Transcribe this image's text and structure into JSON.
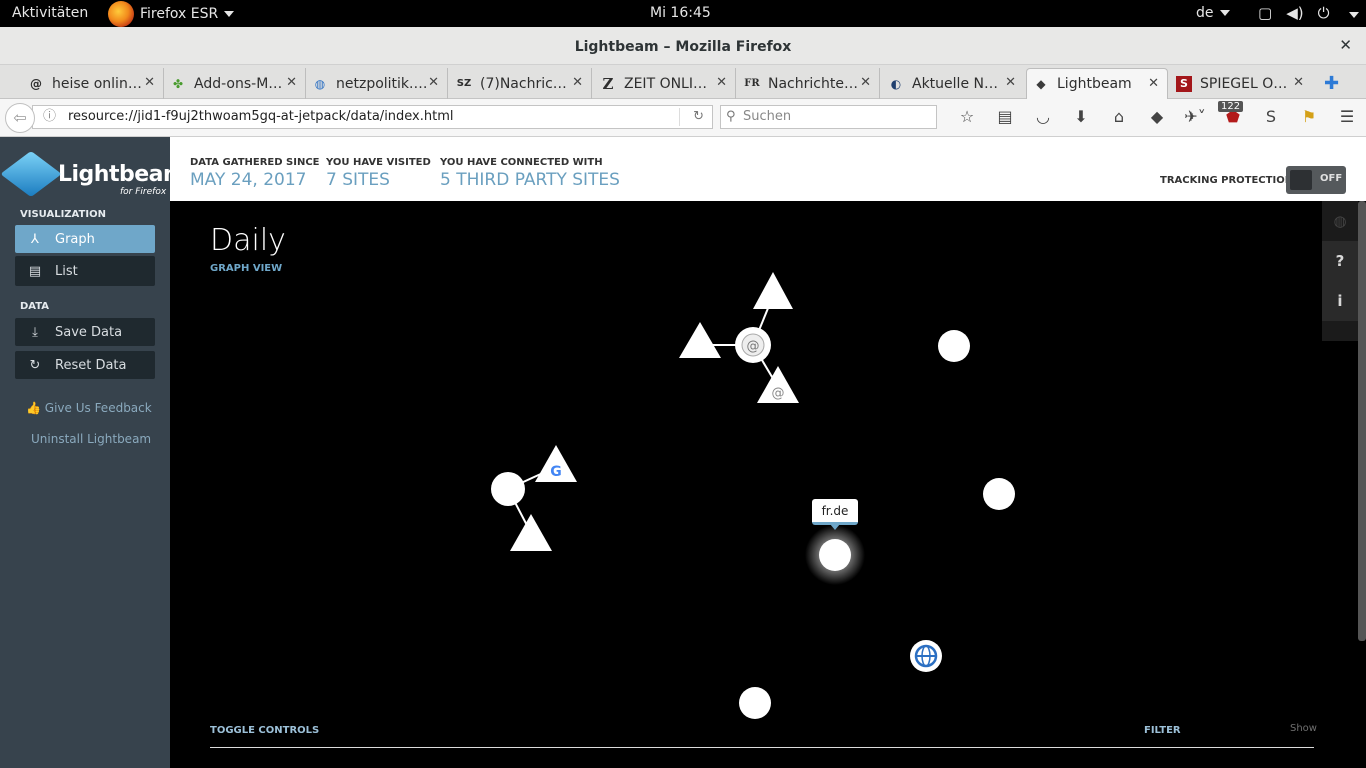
{
  "topbar": {
    "activities": "Aktivitäten",
    "app_name": "Firefox ESR",
    "clock": "Mi 16:45",
    "lang": "de"
  },
  "window": {
    "title": "Lightbeam – Mozilla Firefox"
  },
  "tabs": [
    {
      "label": "heise onlin…",
      "icon": "heise-favicon",
      "favi": "@"
    },
    {
      "label": "Add-ons-M…",
      "icon": "puzzle-favicon",
      "favi": "✤"
    },
    {
      "label": "netzpolitik.…",
      "icon": "globe-favicon",
      "favi": "◍"
    },
    {
      "label": "(7)Nachric…",
      "icon": "sz-favicon",
      "favi": "SZ"
    },
    {
      "label": "ZEIT ONLI…",
      "icon": "zeit-favicon",
      "favi": "Z"
    },
    {
      "label": "Nachrichte…",
      "icon": "fr-favicon",
      "favi": "FR"
    },
    {
      "label": "Aktuelle N…",
      "icon": "dlf-favicon",
      "favi": "◐"
    },
    {
      "label": "Lightbeam",
      "icon": "lightbeam-favicon",
      "favi": "◆"
    },
    {
      "label": "SPIEGEL O…",
      "icon": "spiegel-favicon",
      "favi": "S"
    }
  ],
  "navbar": {
    "url": "resource://jid1-f9uj2thwoam5gq-at-jetpack/data/index.html",
    "search_placeholder": "Suchen",
    "badge_count": "122"
  },
  "sidebar": {
    "brand": "Lightbeam",
    "brand_sub": "for Firefox",
    "visualization_heading": "VISUALIZATION",
    "graph": "Graph",
    "list": "List",
    "data_heading": "DATA",
    "save": "Save Data",
    "reset": "Reset Data",
    "feedback": "Give Us Feedback",
    "uninstall": "Uninstall Lightbeam"
  },
  "header": {
    "gathered_label": "DATA GATHERED SINCE",
    "gathered_value": "MAY 24, 2017",
    "visited_label": "YOU HAVE VISITED",
    "visited_value": "7 SITES",
    "connected_label": "YOU HAVE CONNECTED WITH",
    "connected_value": "5 THIRD PARTY SITES",
    "tracking_label": "TRACKING PROTECTION",
    "tracking_state": "OFF"
  },
  "viz": {
    "title": "Daily",
    "subtitle": "GRAPH VIEW",
    "tooltip": "fr.de",
    "toggle_controls": "TOGGLE CONTROLS",
    "filter": "FILTER",
    "show": "Show"
  },
  "colors": {
    "accent": "#6fa7c9",
    "sidebar_bg": "#37434d",
    "button_dark": "#1f292f"
  }
}
